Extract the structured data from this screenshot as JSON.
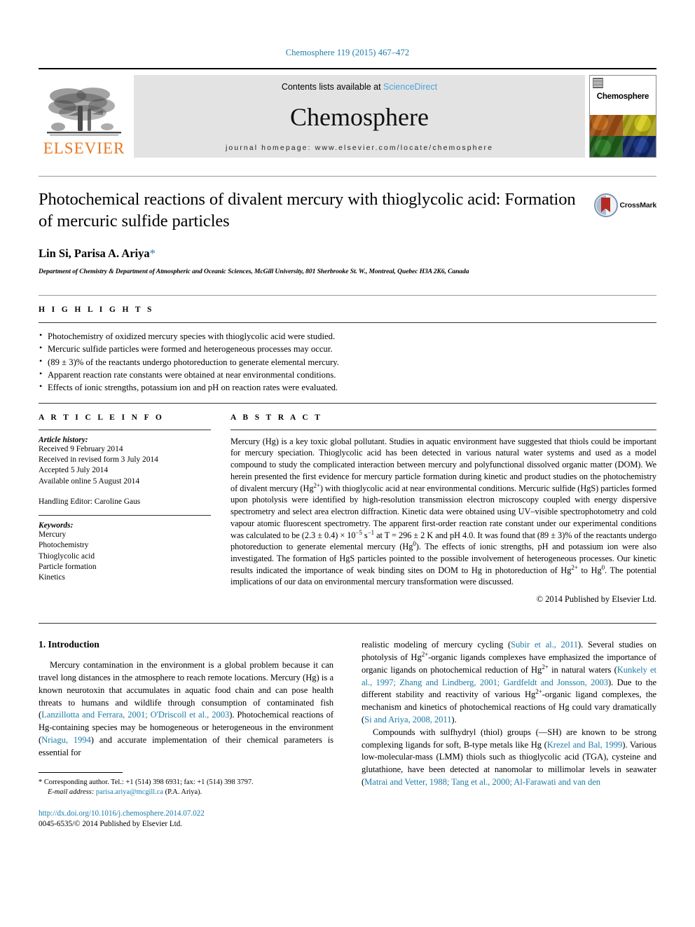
{
  "running_head": "Chemosphere 119 (2015) 467–472",
  "masthead": {
    "publisher": "ELSEVIER",
    "contents_prefix": "Contents lists available at ",
    "sciencedirect": "ScienceDirect",
    "journal_title": "Chemosphere",
    "homepage": "journal homepage: www.elsevier.com/locate/chemosphere",
    "cover_journal_name": "Chemosphere"
  },
  "article": {
    "title": "Photochemical reactions of divalent mercury with thioglycolic acid: Formation of mercuric sulfide particles",
    "authors": "Lin Si, Parisa A. Ariya",
    "author_star": "*",
    "affiliation": "Department of Chemistry & Department of Atmospheric and Oceanic Sciences, McGill University, 801 Sherbrooke St. W., Montreal, Quebec H3A 2K6, Canada",
    "crossmark_label": "CrossMark"
  },
  "highlights": {
    "label": "H I G H L I G H T S",
    "items": [
      "Photochemistry of oxidized mercury species with thioglycolic acid were studied.",
      "Mercuric sulfide particles were formed and heterogeneous processes may occur.",
      "(89 ± 3)% of the reactants undergo photoreduction to generate elemental mercury.",
      "Apparent reaction rate constants were obtained at near environmental conditions.",
      "Effects of ionic strengths, potassium ion and pH on reaction rates were evaluated."
    ]
  },
  "article_info": {
    "label": "A R T I C L E    I N F O",
    "history_heading": "Article history:",
    "history": [
      "Received 9 February 2014",
      "Received in revised form 3 July 2014",
      "Accepted 5 July 2014",
      "Available online 5 August 2014"
    ],
    "handling_editor": "Handling Editor: Caroline Gaus",
    "keywords_heading": "Keywords:",
    "keywords": [
      "Mercury",
      "Photochemistry",
      "Thioglycolic acid",
      "Particle formation",
      "Kinetics"
    ]
  },
  "abstract": {
    "label": "A B S T R A C T",
    "text": "Mercury (Hg) is a key toxic global pollutant. Studies in aquatic environment have suggested that thiols could be important for mercury speciation. Thioglycolic acid has been detected in various natural water systems and used as a model compound to study the complicated interaction between mercury and polyfunctional dissolved organic matter (DOM). We herein presented the first evidence for mercury particle formation during kinetic and product studies on the photochemistry of divalent mercury (Hg2+) with thioglycolic acid at near environmental conditions. Mercuric sulfide (HgS) particles formed upon photolysis were identified by high-resolution transmission electron microscopy coupled with energy dispersive spectrometry and select area electron diffraction. Kinetic data were obtained using UV–visible spectrophotometry and cold vapour atomic fluorescent spectrometry. The apparent first-order reaction rate constant under our experimental conditions was calculated to be (2.3 ± 0.4) × 10−5 s−1 at T = 296 ± 2 K and pH 4.0. It was found that (89 ± 3)% of the reactants undergo photoreduction to generate elemental mercury (Hg0). The effects of ionic strengths, pH and potassium ion were also investigated. The formation of HgS particles pointed to the possible involvement of heterogeneous processes. Our kinetic results indicated the importance of weak binding sites on DOM to Hg in photoreduction of Hg2+ to Hg0. The potential implications of our data on environmental mercury transformation were discussed.",
    "copyright": "© 2014 Published by Elsevier Ltd."
  },
  "body": {
    "section_heading": "1. Introduction",
    "left_paragraph_parts": {
      "p1a": "Mercury contamination in the environment is a global problem because it can travel long distances in the atmosphere to reach remote locations. Mercury (Hg) is a known neurotoxin that accumulates in aquatic food chain and can pose health threats to humans and wildlife through consumption of contaminated fish (",
      "cite1": "Lanzillotta and Ferrara, 2001; O'Driscoll et al., 2003",
      "p1b": "). Photochemical reactions of Hg-containing species may be homogeneous or heterogeneous in the environment (",
      "cite2": "Nriagu, 1994",
      "p1c": ") and accurate implementation of their chemical parameters is essential for"
    },
    "right_paragraph_parts": {
      "p2a": "realistic modeling of mercury cycling (",
      "cite3": "Subir et al., 2011",
      "p2b": "). Several studies on photolysis of Hg2+-organic ligands complexes have emphasized the importance of organic ligands on photochemical reduction of Hg2+ in natural waters (",
      "cite4": "Kunkely et al., 1997; Zhang and Lindberg, 2001; Gardfeldt and Jonsson, 2003",
      "p2c": "). Due to the different stability and reactivity of various Hg2+-organic ligand complexes, the mechanism and kinetics of photochemical reactions of Hg could vary dramatically (",
      "cite5": "Si and Ariya, 2008, 2011",
      "p2d": ").",
      "p3a": "Compounds with sulfhydryl (thiol) groups (—SH) are known to be strong complexing ligands for soft, B-type metals like Hg (",
      "cite6": "Krezel and Bal, 1999",
      "p3b": "). Various low-molecular-mass (LMM) thiols such as thioglycolic acid (TGA), cysteine and glutathione, have been detected at nanomolar to millimolar levels in seawater (",
      "cite7": "Matrai and Vetter, 1988; Tang et al., 2000; Al-Farawati and van den"
    }
  },
  "footer": {
    "corresponding_marker": "*",
    "corresponding": "Corresponding author. Tel.: +1 (514) 398 6931; fax: +1 (514) 398 3797.",
    "email_label": "E-mail address:",
    "email": "parisa.ariya@mcgill.ca",
    "email_owner": "(P.A. Ariya).",
    "doi": "http://dx.doi.org/10.1016/j.chemosphere.2014.07.022",
    "issn": "0045-6535/© 2014 Published by Elsevier Ltd."
  },
  "colors": {
    "link_blue": "#1a7ba8",
    "sciencedirect_blue": "#4ea3d8",
    "elsevier_orange": "#E87722",
    "banner_gray": "#e3e3e3"
  }
}
